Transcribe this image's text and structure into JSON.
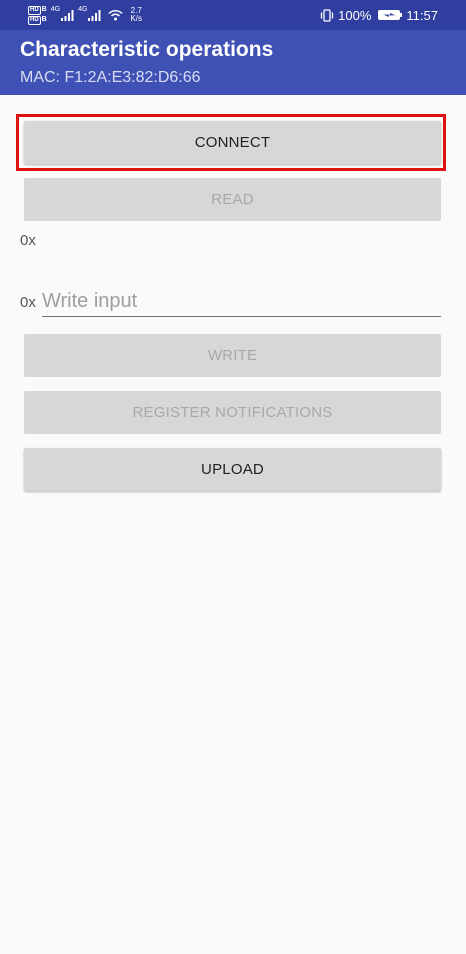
{
  "status_bar": {
    "hd_label": "HD",
    "hd_sub": "B",
    "network_label": "4G",
    "speed_value": "2.7",
    "speed_unit": "K/s",
    "battery_percent": "100%",
    "time": "11:57",
    "text_color": "#ffffff"
  },
  "app_bar": {
    "title": "Characteristic operations",
    "subtitle": "MAC: F1:2A:E3:82:D6:66",
    "color": "#3f51b5",
    "status_color": "#303f9f"
  },
  "main": {
    "connect_label": "CONNECT",
    "read_label": "READ",
    "read_value": "0x",
    "write_prefix": "0x",
    "write_placeholder": "Write input",
    "write_value": "",
    "write_label": "WRITE",
    "register_notifications_label": "REGISTER NOTIFICATIONS",
    "upload_label": "UPLOAD",
    "highlight_color": "#e01010"
  }
}
